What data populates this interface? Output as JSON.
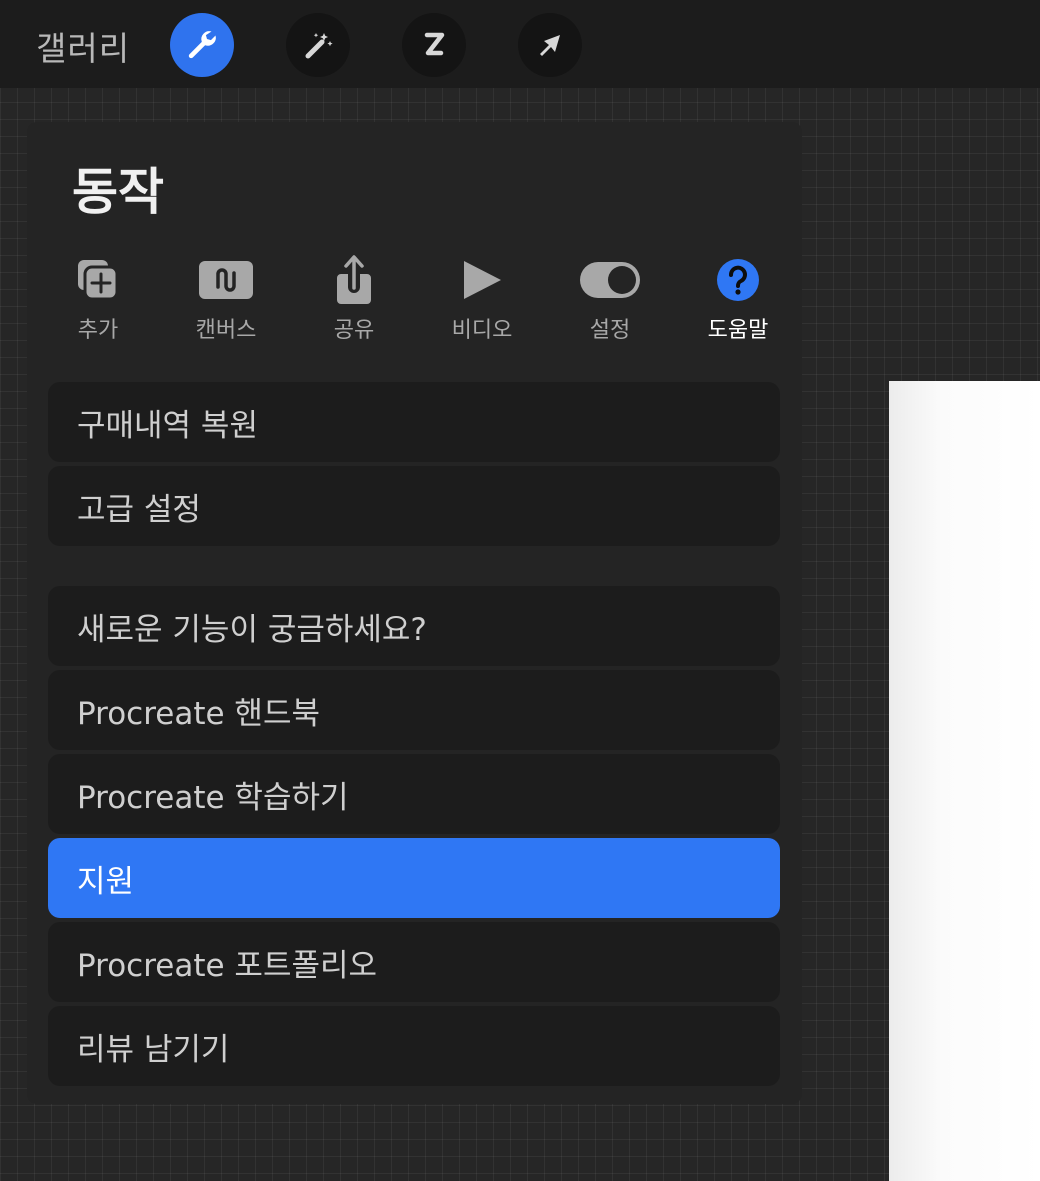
{
  "topbar": {
    "gallery_label": "갤러리",
    "tools": [
      {
        "icon": "wrench-icon",
        "active": true
      },
      {
        "icon": "magic-wand-icon",
        "active": false
      },
      {
        "icon": "selection-s-icon",
        "active": false
      },
      {
        "icon": "transform-arrow-icon",
        "active": false
      }
    ]
  },
  "panel": {
    "title": "동작",
    "tabs": [
      {
        "label": "추가",
        "icon": "add-icon"
      },
      {
        "label": "캔버스",
        "icon": "canvas-icon"
      },
      {
        "label": "공유",
        "icon": "share-icon"
      },
      {
        "label": "비디오",
        "icon": "video-play-icon"
      },
      {
        "label": "설정",
        "icon": "settings-toggle-icon"
      },
      {
        "label": "도움말",
        "icon": "help-icon",
        "active": true
      }
    ],
    "group1": [
      {
        "label": "구매내역 복원"
      },
      {
        "label": "고급 설정"
      }
    ],
    "group2": [
      {
        "label": "새로운 기능이 궁금하세요?"
      },
      {
        "label": "Procreate 핸드북"
      },
      {
        "label": "Procreate 학습하기"
      },
      {
        "label": "지원",
        "selected": true
      },
      {
        "label": "Procreate 포트폴리오"
      },
      {
        "label": "리뷰 남기기"
      }
    ]
  },
  "colors": {
    "accent": "#2f77f4",
    "panel_bg": "#242424",
    "item_bg": "#1c1c1c",
    "topbar_bg": "#1c1c1c"
  }
}
